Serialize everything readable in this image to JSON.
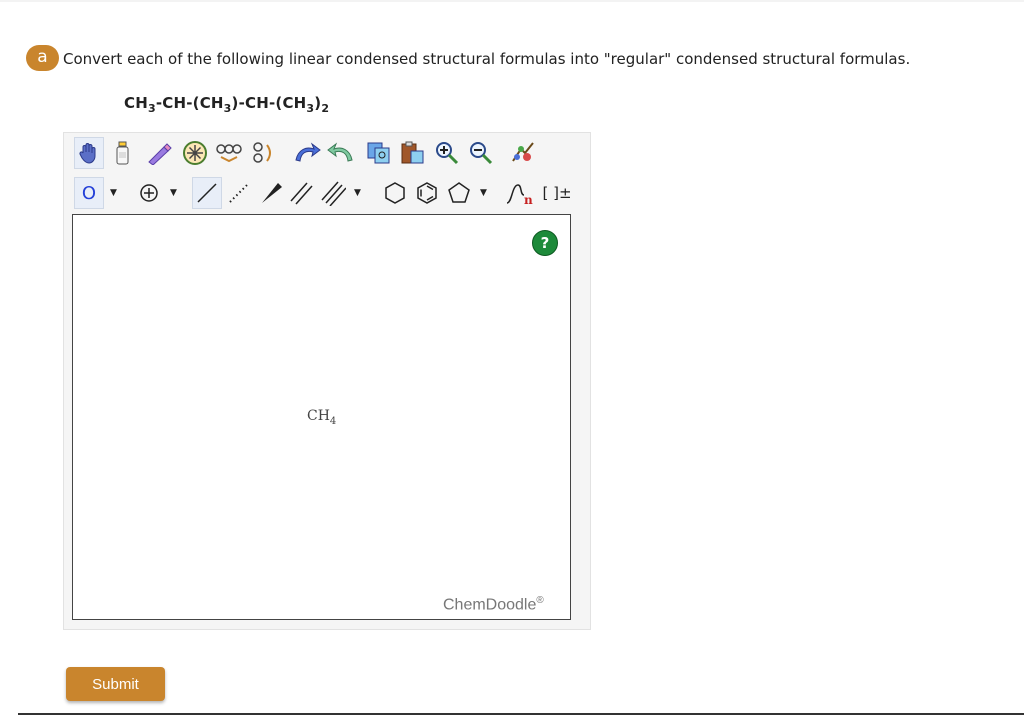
{
  "question": {
    "badge": "a",
    "text": "Convert each of the following linear condensed structural formulas into \"regular\" condensed structural formulas.",
    "formula": "CH3-CH-(CH3)-CH-(CH3)2"
  },
  "toolbar": {
    "row1": [
      "hand-tool",
      "clear-bottle",
      "eraser",
      "center-tool",
      "flip-tool",
      "flip-tool-2",
      "undo",
      "redo",
      "copy",
      "paste",
      "zoom-in",
      "zoom-out",
      "clean-tool"
    ],
    "row2": {
      "atom_label": "O",
      "charge_label": "+",
      "dropdown_glyph": "▼",
      "bracket_label": "[ ]±",
      "repeat_label": "n"
    }
  },
  "canvas": {
    "help": "?",
    "molecule_main": "CH",
    "molecule_sub": "4",
    "brand": "ChemDoodle",
    "brand_mark": "®"
  },
  "submit_label": "Submit",
  "colors": {
    "accent": "#c9852d",
    "help_green": "#1d8a3a"
  }
}
